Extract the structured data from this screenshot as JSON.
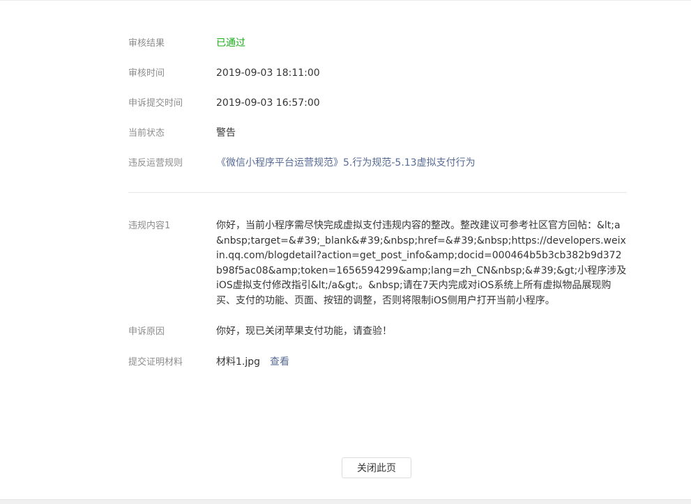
{
  "review": {
    "result_label": "审核结果",
    "result_value": "已通过",
    "time_label": "审核时间",
    "time_value": "2019-09-03 18:11:00",
    "appeal_time_label": "申诉提交时间",
    "appeal_time_value": "2019-09-03 16:57:00",
    "status_label": "当前状态",
    "status_value": "警告",
    "rule_label": "违反运营规则",
    "rule_value": "《微信小程序平台运营规范》5.行为规范-5.13虚拟支付行为"
  },
  "violation": {
    "content_label": "违规内容1",
    "content_value": "你好，当前小程序需尽快完成虚拟支付违规内容的整改。整改建议可参考社区官方回帖：&lt;a &nbsp;target=&#39;_blank&#39;&nbsp;href=&#39;&nbsp;https://developers.weixin.qq.com/blogdetail?action=get_post_info&amp;docid=000464b5b3cb382b9d372b98f5ac08&amp;token=1656594299&amp;lang=zh_CN&nbsp;&#39;&gt;小程序涉及iOS虚拟支付修改指引&lt;/a&gt;。&nbsp;请在7天内完成对iOS系统上所有虚拟物品展现购买、支付的功能、页面、按钮的调整，否则将限制iOS侧用户打开当前小程序。",
    "reason_label": "申诉原因",
    "reason_value": "你好，现已关闭苹果支付功能，请查验！",
    "material_label": "提交证明材料",
    "material_file": "材料1.jpg",
    "material_view": "查看"
  },
  "footer": {
    "close_label": "关闭此页"
  },
  "colors": {
    "success": "#1aad19",
    "link": "#576b95",
    "label": "#8d8d8d"
  }
}
